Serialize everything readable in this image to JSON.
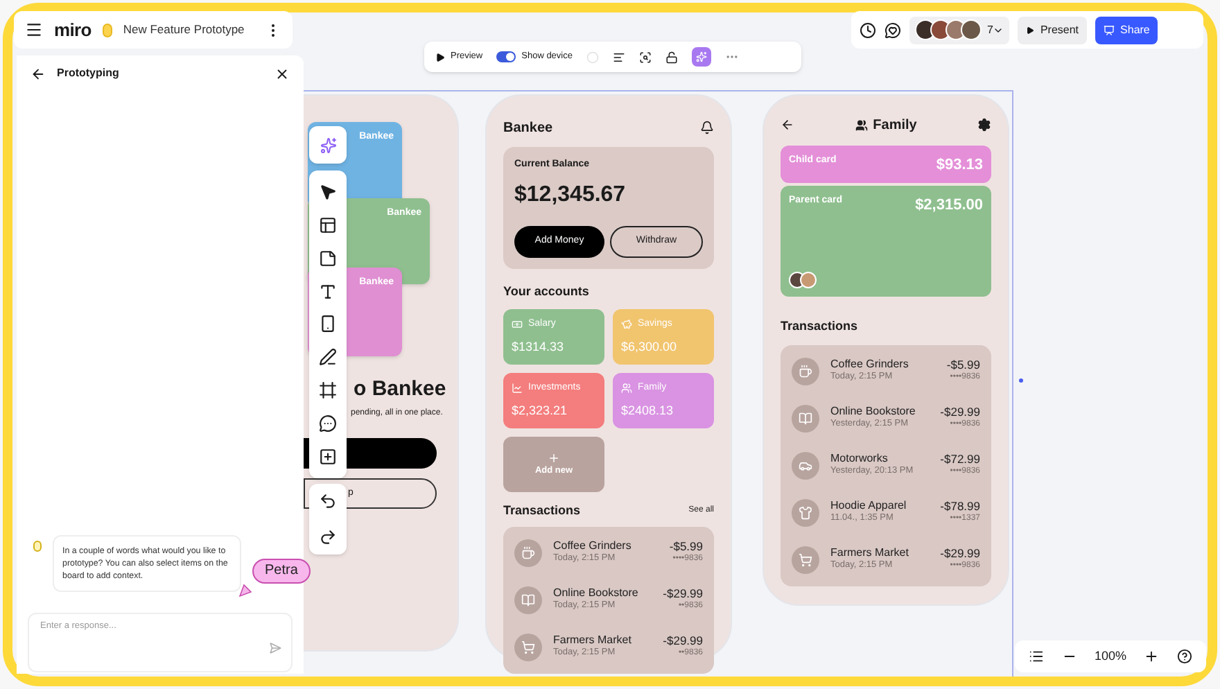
{
  "header": {
    "logo": "miro",
    "board_title": "New Feature Prototype"
  },
  "toolbar": {
    "preview": "Preview",
    "show_device": {
      "label": "Show device",
      "on": true
    }
  },
  "collaborators": {
    "count": "7"
  },
  "actions": {
    "present": "Present",
    "share": "Share"
  },
  "panel": {
    "title": "Prototyping",
    "message": "In a couple of words what would you like to prototype? You can also select items on the board to add context.",
    "input": {
      "placeholder": "Enter a response..."
    }
  },
  "cursor": {
    "name": "Petra"
  },
  "welcome_screen": {
    "cards": [
      {
        "label": "Bankee",
        "color": "#6fb3e3"
      },
      {
        "label": "Bankee",
        "color": "#8fbf8f"
      },
      {
        "label": "Bankee",
        "color": "#e08fd2"
      }
    ],
    "title": "o Bankee",
    "subtitle": "pending, all in one place.",
    "secondary_button": "p"
  },
  "home_screen": {
    "title": "Bankee",
    "balance_label": "Current Balance",
    "balance": "$12,345.67",
    "buttons": [
      "Add Money",
      "Withdraw"
    ],
    "accounts_title": "Your accounts",
    "accounts": [
      {
        "kind": "salary",
        "name": "Salary",
        "amount": "$1314.33",
        "color": "#8fbf8f"
      },
      {
        "kind": "savings",
        "name": "Savings",
        "amount": "$6,300.00",
        "color": "#f1c46e"
      },
      {
        "kind": "investments",
        "name": "Investments",
        "amount": "$2,323.21",
        "color": "#f47d7d"
      },
      {
        "kind": "family",
        "name": "Family",
        "amount": "$2408.13",
        "color": "#d993e2"
      }
    ],
    "add_new": "Add new",
    "transactions_title": "Transactions",
    "see_all": "See all",
    "transactions": [
      {
        "kind": "coffee",
        "name": "Coffee Grinders",
        "date": "Today, 2:15 PM",
        "amount": "-$5.99",
        "card": "••••9836"
      },
      {
        "kind": "book",
        "name": "Online Bookstore",
        "date": "Today, 2:15 PM",
        "amount": "-$29.99",
        "card": "••9836"
      },
      {
        "kind": "cart",
        "name": "Farmers Market",
        "date": "Today, 2:15 PM",
        "amount": "-$29.99",
        "card": "••9836"
      }
    ]
  },
  "family_screen": {
    "title": "Family",
    "cards": [
      {
        "name": "Child card",
        "amount": "$93.13",
        "color": "#e48fd8"
      },
      {
        "name": "Parent card",
        "amount": "$2,315.00",
        "color": "#8fbf8f"
      }
    ],
    "transactions_title": "Transactions",
    "transactions": [
      {
        "kind": "coffee",
        "name": "Coffee Grinders",
        "date": "Today, 2:15 PM",
        "amount": "-$5.99",
        "card": "••••9836"
      },
      {
        "kind": "book",
        "name": "Online Bookstore",
        "date": "Yesterday, 2:15 PM",
        "amount": "-$29.99",
        "card": "••••9836"
      },
      {
        "kind": "car",
        "name": "Motorworks",
        "date": "Yesterday, 20:13 PM",
        "amount": "-$72.99",
        "card": "••••9836"
      },
      {
        "kind": "shirt",
        "name": "Hoodie Apparel",
        "date": "11.04., 1:35 PM",
        "amount": "-$78.99",
        "card": "••••1337"
      },
      {
        "kind": "cart",
        "name": "Farmers Market",
        "date": "Today, 2:15 PM",
        "amount": "-$29.99",
        "card": "••••9836"
      }
    ]
  },
  "zoom": {
    "value": "100%"
  }
}
